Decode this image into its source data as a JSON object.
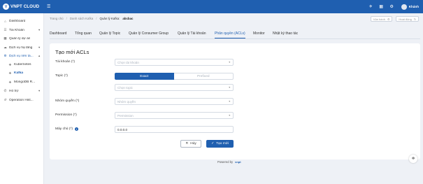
{
  "header": {
    "logo_mark": "V",
    "logo_text": "VNPT CLOUD",
    "menu_icon": "hamburger-icon",
    "user_name": "Khánh"
  },
  "sidebar": {
    "items": [
      {
        "label": "Dashboard",
        "icon": "⌂"
      },
      {
        "label": "Tài Khoản",
        "icon": "☰",
        "chevron": "▼"
      },
      {
        "label": "Quản lý dự án",
        "icon": "▦"
      },
      {
        "label": "Dịch vụ hạ tầng",
        "icon": "☁",
        "chevron": "▼"
      },
      {
        "label": "Dịch vụ nền tả...",
        "icon": "⚙",
        "chevron": "▲"
      },
      {
        "label": "Kubernetes",
        "icon": "⎈"
      },
      {
        "label": "Kafka",
        "icon": "⎈"
      },
      {
        "label": "MongoDB R...",
        "icon": "⎈"
      },
      {
        "label": "Hỗ trợ",
        "icon": "✆",
        "chevron": "▼"
      },
      {
        "label": "Operation Hist...",
        "icon": "↺"
      }
    ]
  },
  "breadcrumb": {
    "items": [
      "Trang chủ",
      "Danh sách Kafka",
      "Quản lý Kafka:"
    ],
    "current": "abcbac",
    "separator": "/"
  },
  "top_actions": {
    "btn1": "Vận hành",
    "btn2": "Hoạt động"
  },
  "tabs": [
    "Dashboard",
    "Tổng quan",
    "Quản lý Topic",
    "Quản lý Consumer Group",
    "Quản lý Tài khoản",
    "Phân quyền (ACLs)",
    "Monitor",
    "Nhật ký thao tác"
  ],
  "form": {
    "title": "Tạo mới ACLs",
    "account_label": "Tài khoản (*)",
    "account_placeholder": "Chọn tài khoản",
    "topic_label": "Topic (*)",
    "topic_exact": "Exact",
    "topic_prefixed": "Prefixed",
    "topic_placeholder": "Chọn topic",
    "group_label": "Nhóm quyền (*)",
    "group_placeholder": "Nhóm quyền",
    "permission_label": "Permission (*)",
    "permission_placeholder": "Permission",
    "host_label": "Máy chủ (*)",
    "host_value": "0.0.0.0",
    "info_glyph": "i",
    "caret": "▼",
    "cancel_label": "Hủy",
    "create_label": "Tạo mới"
  },
  "footer": {
    "powered_by": "Powered by",
    "brand": "vnpt"
  },
  "colors": {
    "primary": "#1f5fb0",
    "background": "#eef1f6"
  }
}
